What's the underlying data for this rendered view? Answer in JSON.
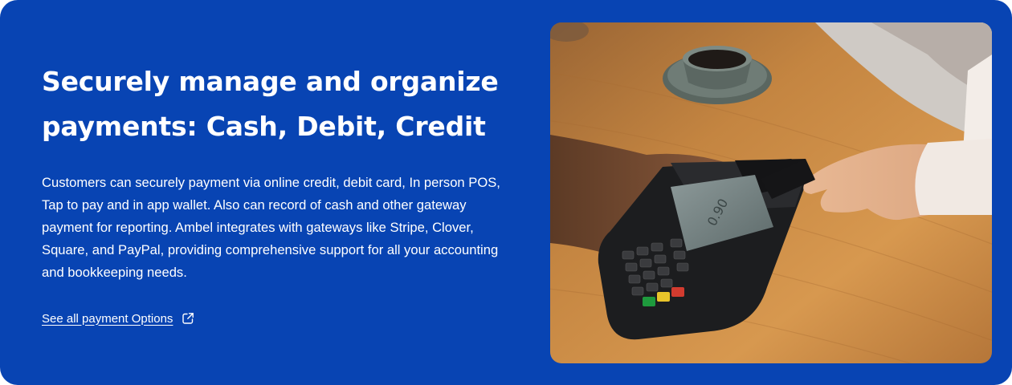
{
  "section": {
    "heading_line1": "Securely manage and organize",
    "heading_line2": "payments: Cash, Debit, Credit",
    "description": "Customers can securely payment via online credit, debit card, In person POS, Tap to pay and in app wallet. Also can record of cash and other gateway payment for reporting. Ambel integrates with gateways like Stripe, Clover, Square, and PayPal, providing comprehensive support for all your accounting and bookkeeping needs.",
    "link_label": "See all payment Options",
    "link_icon": "external-link-icon"
  },
  "photo": {
    "terminal_screen_text": "0.90"
  },
  "colors": {
    "background": "#0844b3",
    "text": "#ffffff",
    "table_wood": "#c98a45"
  }
}
